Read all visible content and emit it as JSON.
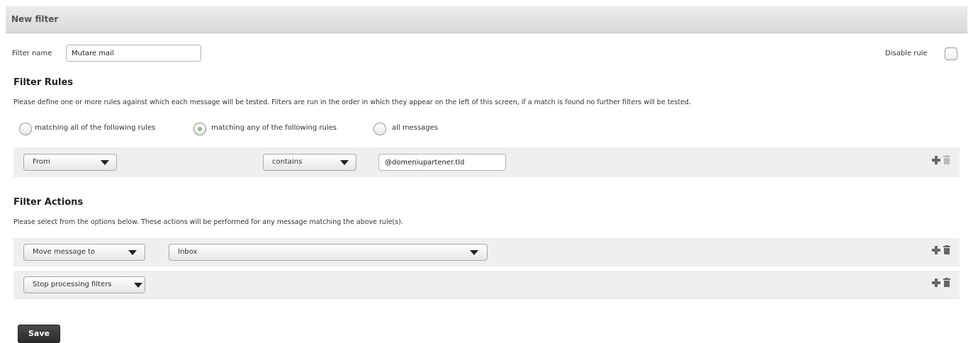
{
  "header": {
    "title": "New filter"
  },
  "filter_name": {
    "label": "Filter name",
    "value": "Mutare mail"
  },
  "disable_rule": {
    "label": "Disable rule",
    "checked": false
  },
  "rules_section": {
    "title": "Filter Rules",
    "description": "Please define one or more rules against which each message will be tested. Filters are run in the order in which they appear on the left of this screen, if a match is found no further filters will be tested.",
    "match_options": [
      {
        "label": "matching all of the following rules",
        "checked": false
      },
      {
        "label": "matching any of the following rules",
        "checked": true
      },
      {
        "label": "all messages",
        "checked": false
      }
    ],
    "rules": [
      {
        "field": "From",
        "operator": "contains",
        "value": "@domeniupartener.tld"
      }
    ]
  },
  "actions_section": {
    "title": "Filter Actions",
    "description": "Please select from the options below. These actions will be performed for any message matching the above rule(s).",
    "actions": [
      {
        "action": "Move message to",
        "target": "Inbox"
      },
      {
        "action": "Stop processing filters"
      }
    ]
  },
  "save_button": {
    "label": "Save"
  },
  "icons": {
    "add": "plus-icon",
    "delete": "trash-icon"
  },
  "colors": {
    "header_bg": "#dcdcdc",
    "row_bg": "#efefef",
    "save_bg": "#333333",
    "radio_checked": "#8db68a"
  }
}
